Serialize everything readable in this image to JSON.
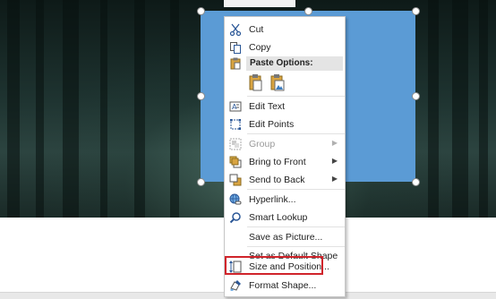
{
  "menu": {
    "items": [
      {
        "label": "Cut",
        "icon": "scissors-icon",
        "enabled": true
      },
      {
        "label": "Copy",
        "icon": "copy-icon",
        "enabled": true
      },
      {
        "label": "Edit Text",
        "icon": "edit-text-icon",
        "enabled": true
      },
      {
        "label": "Edit Points",
        "icon": "edit-points-icon",
        "enabled": true
      },
      {
        "label": "Group",
        "icon": "group-icon",
        "enabled": false,
        "submenu": true
      },
      {
        "label": "Bring to Front",
        "icon": "bring-to-front-icon",
        "enabled": true,
        "submenu": true
      },
      {
        "label": "Send to Back",
        "icon": "send-to-back-icon",
        "enabled": true,
        "submenu": true
      },
      {
        "label": "Hyperlink...",
        "icon": "hyperlink-icon",
        "enabled": true
      },
      {
        "label": "Smart Lookup",
        "icon": "search-icon",
        "enabled": true
      },
      {
        "label": "Save as Picture...",
        "icon": "",
        "enabled": true
      },
      {
        "label": "Set as Default Shape",
        "icon": "",
        "enabled": true
      },
      {
        "label": "Size and Position...",
        "icon": "size-position-icon",
        "enabled": true,
        "highlighted": true
      },
      {
        "label": "Format Shape...",
        "icon": "format-shape-icon",
        "enabled": true
      }
    ],
    "paste_options_label": "Paste Options:",
    "paste_options": [
      "paste-keep-formatting-icon",
      "paste-as-picture-icon"
    ],
    "submenu_arrow": "▶"
  },
  "colors": {
    "shape_fill": "#5b9bd5",
    "highlight_border": "#d0242b"
  }
}
